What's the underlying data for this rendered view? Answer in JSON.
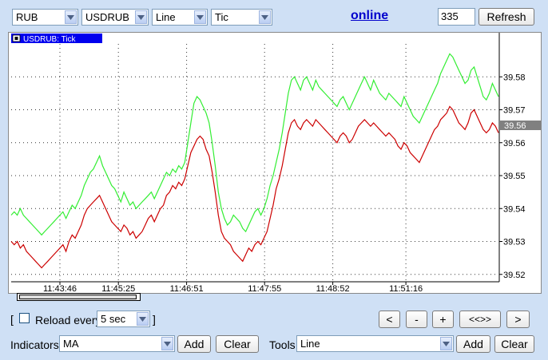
{
  "toolbar": {
    "currency": "RUB",
    "symbol": "USDRUB",
    "chart_style": "Line",
    "interval": "Tic",
    "online_label": "online",
    "count_value": "335",
    "refresh_label": "Refresh"
  },
  "chart_header": {
    "icon": "chart-mode-icon",
    "title": "USDRUB: Tick"
  },
  "current_price": "39.56",
  "colors": {
    "bid": "#cc0000",
    "ask": "#33ee33",
    "header": "#0000ee",
    "price_tag": "#808080"
  },
  "reload": {
    "bracket_open": "[",
    "label": "Reload every",
    "interval": "5 sec",
    "bracket_close": "]",
    "checked": false
  },
  "nav": {
    "prev": "<",
    "minus": "-",
    "plus": "+",
    "fit": "<<>>",
    "next": ">"
  },
  "indicators": {
    "label": "Indicators",
    "value": "MA",
    "add": "Add",
    "clear": "Clear"
  },
  "tools": {
    "label": "Tools",
    "value": "Line",
    "add": "Add",
    "clear": "Clear"
  },
  "chart_data": {
    "type": "line",
    "ylim": [
      39.518,
      39.59
    ],
    "y_ticks": [
      "39.58",
      "39.57",
      "39.56",
      "39.55",
      "39.54",
      "39.53",
      "39.52"
    ],
    "x_ticks": [
      "11:43:46",
      "11:45:25",
      "11:46:51",
      "11:47:55",
      "11:48:52",
      "11:51:16"
    ],
    "x_tick_positions": [
      0.1,
      0.22,
      0.36,
      0.52,
      0.66,
      0.81
    ],
    "grid": true,
    "series": [
      {
        "color": "#33ee33",
        "values": [
          39.538,
          39.539,
          39.538,
          39.54,
          39.538,
          39.537,
          39.536,
          39.535,
          39.534,
          39.533,
          39.532,
          39.533,
          39.534,
          39.535,
          39.536,
          39.537,
          39.538,
          39.539,
          39.537,
          39.539,
          39.541,
          39.54,
          39.542,
          39.544,
          39.547,
          39.549,
          39.551,
          39.552,
          39.554,
          39.556,
          39.553,
          39.551,
          39.549,
          39.547,
          39.546,
          39.544,
          39.542,
          39.545,
          39.543,
          39.541,
          39.542,
          39.54,
          39.541,
          39.542,
          39.543,
          39.544,
          39.545,
          39.543,
          39.545,
          39.547,
          39.549,
          39.551,
          39.55,
          39.552,
          39.551,
          39.553,
          39.552,
          39.554,
          39.56,
          39.566,
          39.572,
          39.574,
          39.573,
          39.571,
          39.569,
          39.566,
          39.56,
          39.553,
          39.545,
          39.54,
          39.537,
          39.535,
          39.536,
          39.538,
          39.537,
          39.536,
          39.534,
          39.533,
          39.535,
          39.537,
          39.539,
          39.54,
          39.538,
          39.54,
          39.543,
          39.547,
          39.55,
          39.554,
          39.558,
          39.563,
          39.569,
          39.575,
          39.579,
          39.58,
          39.578,
          39.576,
          39.579,
          39.58,
          39.578,
          39.576,
          39.579,
          39.577,
          39.576,
          39.575,
          39.574,
          39.573,
          39.572,
          39.571,
          39.573,
          39.574,
          39.572,
          39.57,
          39.572,
          39.574,
          39.576,
          39.578,
          39.58,
          39.578,
          39.576,
          39.579,
          39.577,
          39.575,
          39.574,
          39.573,
          39.575,
          39.574,
          39.573,
          39.572,
          39.571,
          39.574,
          39.572,
          39.57,
          39.568,
          39.567,
          39.566,
          39.568,
          39.57,
          39.572,
          39.574,
          39.576,
          39.578,
          39.581,
          39.583,
          39.585,
          39.587,
          39.586,
          39.584,
          39.582,
          39.58,
          39.578,
          39.579,
          39.582,
          39.583,
          39.58,
          39.577,
          39.574,
          39.573,
          39.575,
          39.578,
          39.576,
          39.574
        ]
      },
      {
        "color": "#cc0000",
        "values": [
          39.53,
          39.529,
          39.53,
          39.528,
          39.529,
          39.527,
          39.526,
          39.525,
          39.524,
          39.523,
          39.522,
          39.523,
          39.524,
          39.525,
          39.526,
          39.527,
          39.528,
          39.529,
          39.527,
          39.53,
          39.532,
          39.531,
          39.533,
          39.535,
          39.538,
          39.54,
          39.541,
          39.542,
          39.543,
          39.544,
          39.542,
          39.54,
          39.538,
          39.536,
          39.535,
          39.534,
          39.533,
          39.535,
          39.534,
          39.532,
          39.533,
          39.531,
          39.532,
          39.533,
          39.535,
          39.537,
          39.538,
          39.536,
          39.538,
          39.54,
          39.541,
          39.544,
          39.545,
          39.547,
          39.546,
          39.548,
          39.547,
          39.549,
          39.553,
          39.557,
          39.559,
          39.561,
          39.562,
          39.561,
          39.558,
          39.556,
          39.551,
          39.545,
          39.538,
          39.533,
          39.531,
          39.53,
          39.529,
          39.527,
          39.526,
          39.525,
          39.524,
          39.526,
          39.528,
          39.527,
          39.529,
          39.53,
          39.529,
          39.531,
          39.533,
          39.537,
          39.541,
          39.546,
          39.549,
          39.553,
          39.558,
          39.563,
          39.566,
          39.567,
          39.565,
          39.564,
          39.566,
          39.567,
          39.566,
          39.565,
          39.567,
          39.566,
          39.565,
          39.564,
          39.563,
          39.562,
          39.561,
          39.56,
          39.562,
          39.563,
          39.562,
          39.56,
          39.561,
          39.563,
          39.565,
          39.566,
          39.567,
          39.566,
          39.565,
          39.566,
          39.565,
          39.564,
          39.563,
          39.562,
          39.563,
          39.562,
          39.561,
          39.559,
          39.558,
          39.56,
          39.559,
          39.557,
          39.556,
          39.555,
          39.554,
          39.556,
          39.558,
          39.56,
          39.562,
          39.564,
          39.565,
          39.567,
          39.568,
          39.569,
          39.571,
          39.57,
          39.568,
          39.566,
          39.565,
          39.564,
          39.566,
          39.569,
          39.57,
          39.568,
          39.566,
          39.564,
          39.563,
          39.564,
          39.566,
          39.565,
          39.563
        ]
      }
    ]
  }
}
